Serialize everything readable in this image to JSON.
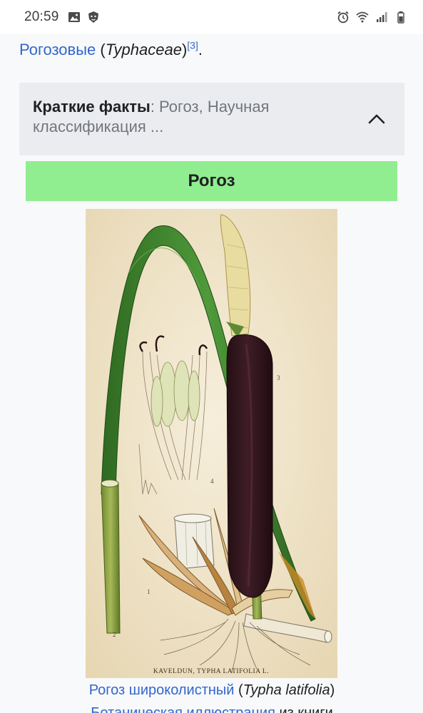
{
  "status_bar": {
    "time": "20:59",
    "left_icons": [
      "image-icon",
      "lion-app-icon"
    ],
    "right_icons": [
      "alarm-icon",
      "wifi-icon",
      "signal-icon",
      "battery-icon"
    ]
  },
  "lead": {
    "link_text": "Рогозовые",
    "paren_open": " (",
    "latin": "Typhaceae",
    "paren_close": ")",
    "ref": "[3]",
    "end": "."
  },
  "infobox": {
    "summary_bold": "Краткие факты",
    "summary_rest": ": Рогоз, Научная классификация ...",
    "title": "Рогоз",
    "image_inscription": "KAVELDUN, TYPHA LATIFOLIA L.",
    "figure_labels": [
      "1",
      "2",
      "3",
      "4"
    ],
    "caption_link": "Рогоз широколистный",
    "caption_paren_open": " (",
    "caption_latin": "Typha latifolia",
    "caption_paren_close": ")",
    "caption_line2_link": "Ботаническая иллюстрация",
    "caption_line2_rest": " из книги"
  },
  "colors": {
    "link": "#3366cc",
    "title_bar": "#90ee90",
    "infobox_bg": "#eaecf0"
  }
}
